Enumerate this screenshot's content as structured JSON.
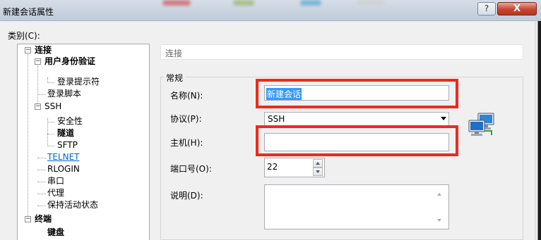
{
  "window": {
    "title": "新建会话属性",
    "help_symbol": "?",
    "close_symbol": "X"
  },
  "category": {
    "label": "类别(C):",
    "tree": {
      "connection": "连接",
      "auth": "用户身份验证",
      "login_prompts": "登录提示符",
      "login_script": "登录脚本",
      "ssh": "SSH",
      "security": "安全性",
      "tunnel": "隧道",
      "sftp": "SFTP",
      "telnet": "TELNET",
      "rlogin": "RLOGIN",
      "serial": "串口",
      "proxy": "代理",
      "keepalive": "保持活动状态",
      "terminal": "终端",
      "keyboard": "键盘"
    }
  },
  "panel": {
    "header": "连接",
    "group_title": "常规",
    "name_label": "名称(N):",
    "name_value": "新建会话",
    "protocol_label": "协议(P):",
    "protocol_value": "SSH",
    "host_label": "主机(H):",
    "host_value": "",
    "port_label": "端口号(O):",
    "port_value": "22",
    "desc_label": "说明(D):",
    "desc_value": ""
  },
  "colors": {
    "highlight": "#ee2a1b",
    "selection": "#3399ff",
    "link": "#0066cc"
  }
}
